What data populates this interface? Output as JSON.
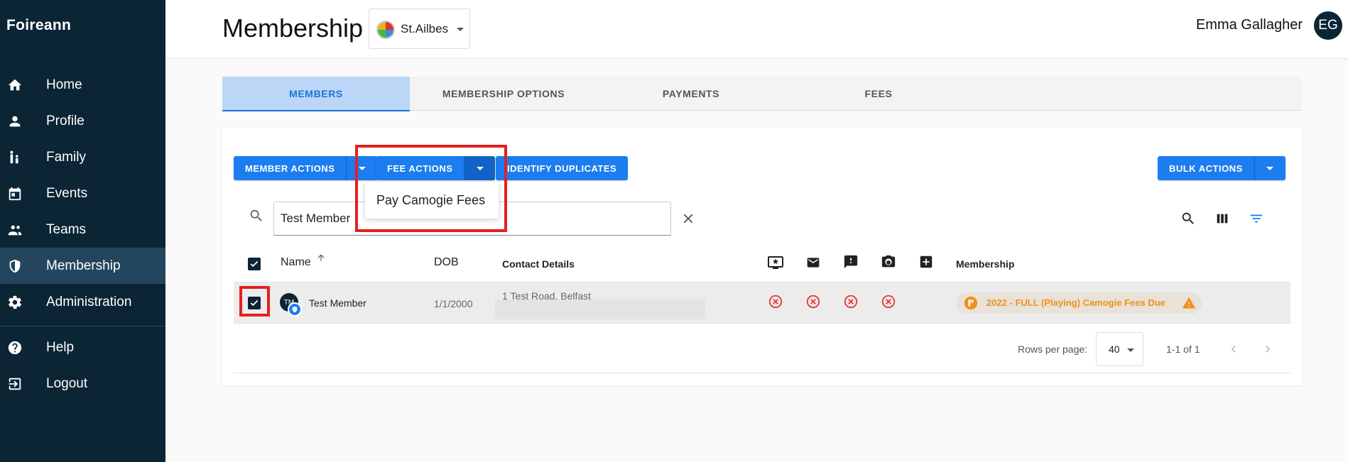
{
  "app": {
    "brand": "Foireann"
  },
  "sidebar": {
    "items": [
      {
        "label": "Home",
        "icon": "home-icon"
      },
      {
        "label": "Profile",
        "icon": "person-icon"
      },
      {
        "label": "Family",
        "icon": "family-icon"
      },
      {
        "label": "Events",
        "icon": "calendar-icon"
      },
      {
        "label": "Teams",
        "icon": "teams-icon"
      },
      {
        "label": "Membership",
        "icon": "shield-icon",
        "active": true
      },
      {
        "label": "Administration",
        "icon": "gear-icon"
      }
    ],
    "secondary": [
      {
        "label": "Help",
        "icon": "help-icon"
      },
      {
        "label": "Logout",
        "icon": "logout-icon"
      }
    ]
  },
  "header": {
    "title": "Membership",
    "club": "St.Ailbes",
    "user_name": "Emma Gallagher",
    "user_initials": "EG"
  },
  "tabs": [
    {
      "label": "MEMBERS",
      "active": true
    },
    {
      "label": "MEMBERSHIP OPTIONS"
    },
    {
      "label": "PAYMENTS"
    },
    {
      "label": "FEES"
    }
  ],
  "toolbar": {
    "member_actions": "MEMBER ACTIONS",
    "fee_actions": "FEE ACTIONS",
    "identify_duplicates": "IDENTIFY DUPLICATES",
    "bulk_actions": "BULK ACTIONS",
    "fee_menu_item": "Pay Camogie Fees"
  },
  "search": {
    "value": "Test Member"
  },
  "table": {
    "headers": {
      "name": "Name",
      "dob": "DOB",
      "contact": "Contact Details",
      "membership": "Membership"
    },
    "rows": [
      {
        "initials": "TM",
        "name": "Test Member",
        "dob": "1/1/2000",
        "address": "1 Test Road, Belfast",
        "membership": "2022 - FULL (Playing) Camogie Fees Due"
      }
    ]
  },
  "pagination": {
    "rows_per_page_label": "Rows per page:",
    "rows_per_page": "40",
    "range": "1-1 of 1"
  },
  "colors": {
    "sidebar_bg": "#0b2535",
    "primary": "#1b7df0",
    "warning": "#f0901a",
    "error": "#e53935",
    "highlight": "#e32020"
  }
}
